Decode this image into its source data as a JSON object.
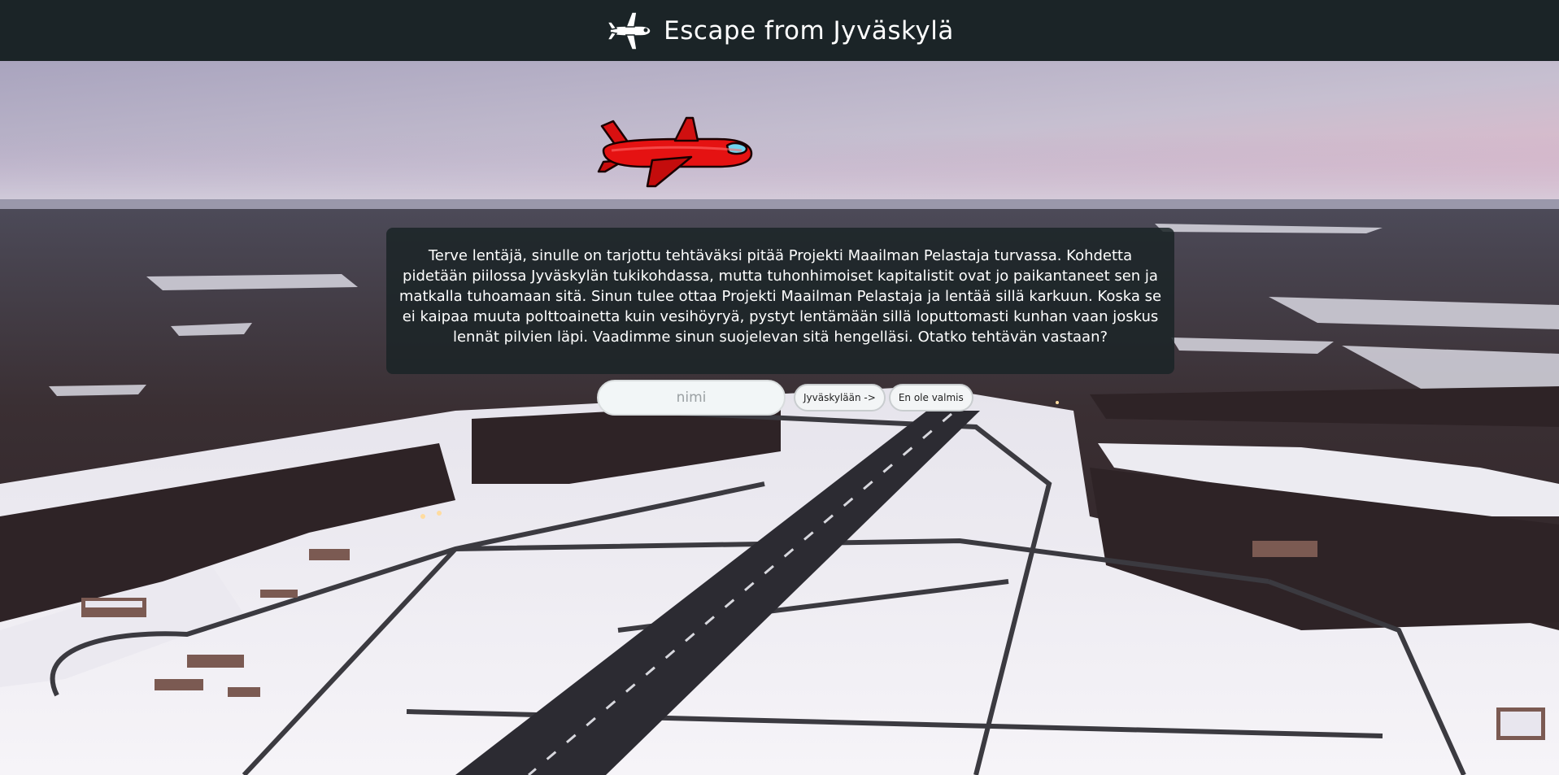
{
  "header": {
    "title": "Escape from Jyväskylä",
    "logo_icon": "airplane-icon"
  },
  "hero": {
    "plane_icon": "red-airplane-icon",
    "plane_color": "#e01010"
  },
  "intro": {
    "text": "Terve lentäjä, sinulle on tarjottu tehtäväksi pitää Projekti Maailman Pelastaja turvassa. Kohdetta pidetään piilossa Jyväskylän tukikohdassa, mutta tuhonhimoiset kapitalistit ovat jo paikantaneet sen ja matkalla tuhoamaan sitä. Sinun tulee ottaa Projekti Maailman Pelastaja ja lentää sillä karkuun. Koska se ei kaipaa muuta polttoainetta kuin vesihöyryä, pystyt lentämään sillä loputtomasti kunhan vaan joskus lennät pilvien läpi. Vaadimme sinun suojelevan sitä hengelläsi. Otatko tehtävän vastaan?"
  },
  "form": {
    "name_placeholder": "nimi",
    "name_value": "",
    "go_label": "Jyväskylään ->",
    "decline_label": "En ole valmis"
  },
  "colors": {
    "header_bg": "#1b2427",
    "dialog_bg": "#1b2427"
  }
}
